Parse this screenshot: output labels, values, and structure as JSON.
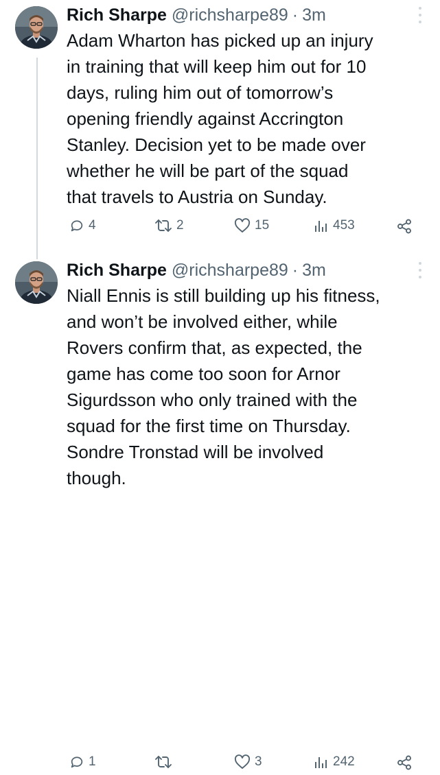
{
  "tweets": [
    {
      "author": {
        "display_name": "Rich Sharpe",
        "handle": "@richsharpe89",
        "avatar_icon": "profile-photo"
      },
      "separator": "·",
      "time": "3m",
      "text": "Adam Wharton has picked up an injury\nin training that will keep him out for 10\ndays, ruling him out of tomorrow’s\nopening friendly against Accrington\nStanley. Decision yet to be made over\nwhether he will be part of the squad\nthat travels to Austria on Sunday.",
      "stats": {
        "replies": "4",
        "reposts": "2",
        "likes": "15",
        "views": "453"
      }
    },
    {
      "author": {
        "display_name": "Rich Sharpe",
        "handle": "@richsharpe89",
        "avatar_icon": "profile-photo"
      },
      "separator": "·",
      "time": "3m",
      "text": "Niall Ennis is still building up his fitness,\nand won’t be involved either, while\nRovers confirm that, as expected, the\ngame has come too soon for Arnor\nSigurdsson who only trained with the\nsquad for the first time on Thursday.\nSondre Tronstad will be involved\nthough.",
      "stats": {
        "replies": "1",
        "reposts": "",
        "likes": "3",
        "views": "242"
      }
    }
  ],
  "colors": {
    "text": "#0f1419",
    "secondary": "#536471",
    "thread_line": "#cfd9de",
    "background": "#ffffff"
  },
  "icons": [
    "reply-icon",
    "repost-icon",
    "like-icon",
    "views-icon",
    "share-icon",
    "more-icon"
  ]
}
